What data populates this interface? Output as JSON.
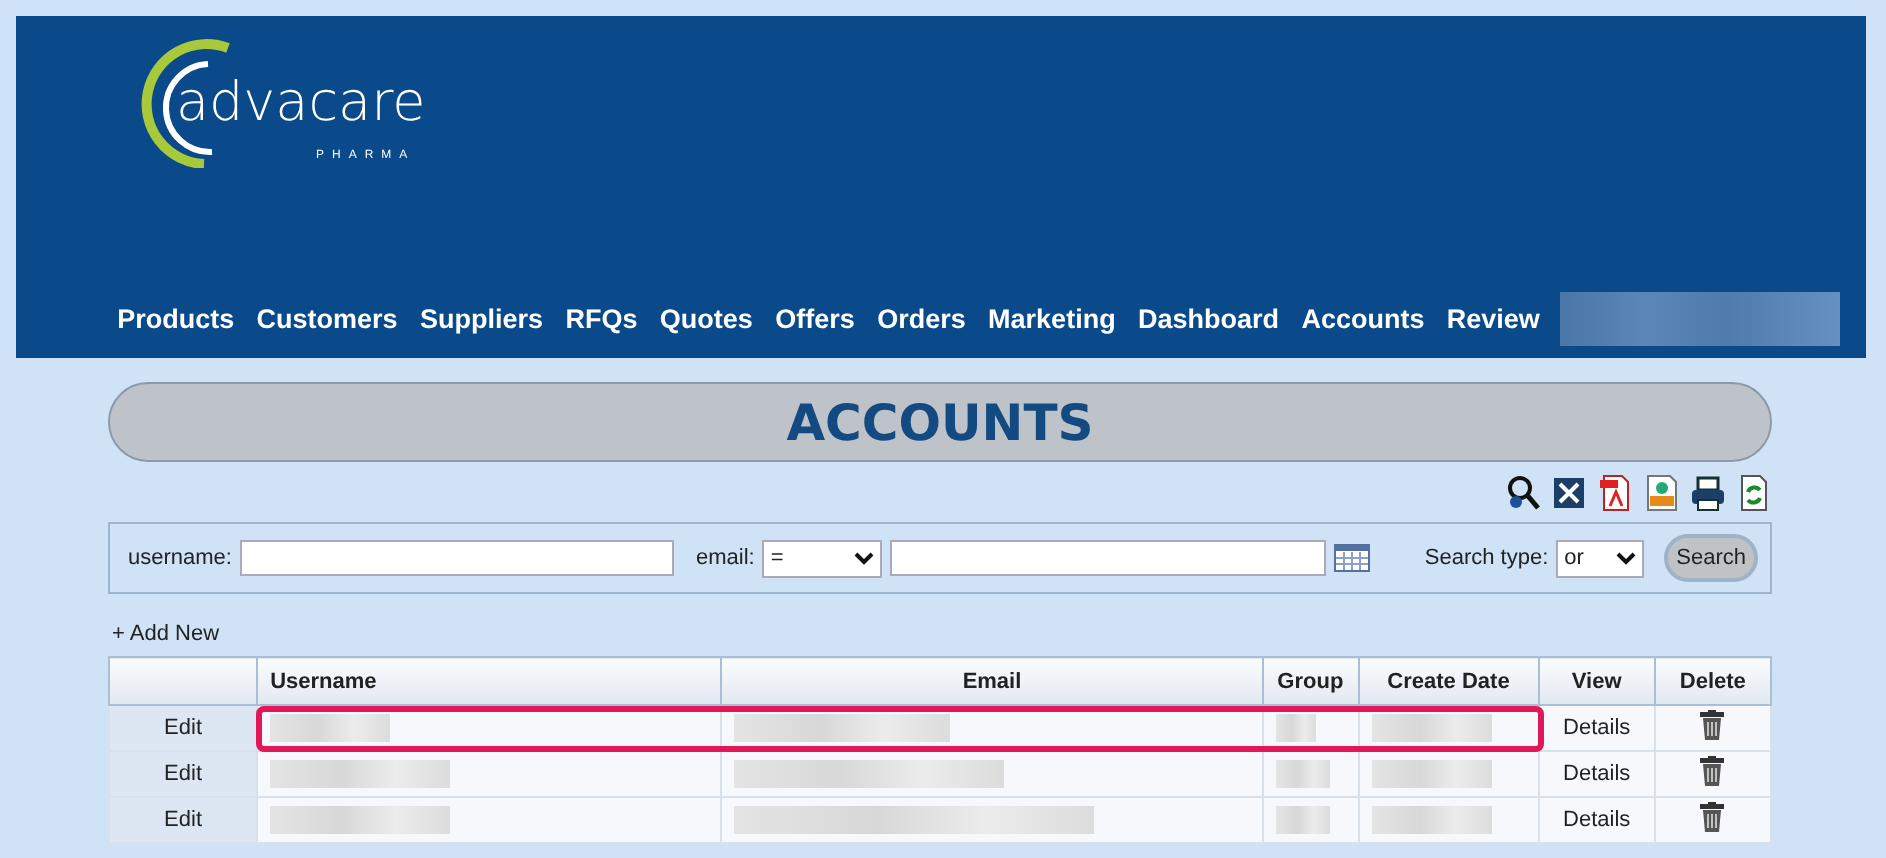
{
  "logo": {
    "name": "advacare",
    "tagline": "PHARMA"
  },
  "nav": [
    {
      "label": "Products"
    },
    {
      "label": "Customers"
    },
    {
      "label": "Suppliers"
    },
    {
      "label": "RFQs"
    },
    {
      "label": "Quotes"
    },
    {
      "label": "Offers"
    },
    {
      "label": "Orders"
    },
    {
      "label": "Marketing"
    },
    {
      "label": "Dashboard"
    },
    {
      "label": "Accounts"
    },
    {
      "label": "Review"
    }
  ],
  "page_title": "ACCOUNTS",
  "search": {
    "username_label": "username:",
    "email_label": "email:",
    "email_operator": "=",
    "search_type_label": "Search type:",
    "search_type": "or",
    "button": "Search"
  },
  "add_new": "+ Add New",
  "table": {
    "columns": [
      "",
      "Username",
      "Email",
      "Group",
      "Create Date",
      "View",
      "Delete"
    ],
    "rows": [
      {
        "edit": "Edit",
        "view": "Details",
        "highlighted": true
      },
      {
        "edit": "Edit",
        "view": "Details",
        "highlighted": false
      },
      {
        "edit": "Edit",
        "view": "Details",
        "highlighted": false
      }
    ]
  }
}
